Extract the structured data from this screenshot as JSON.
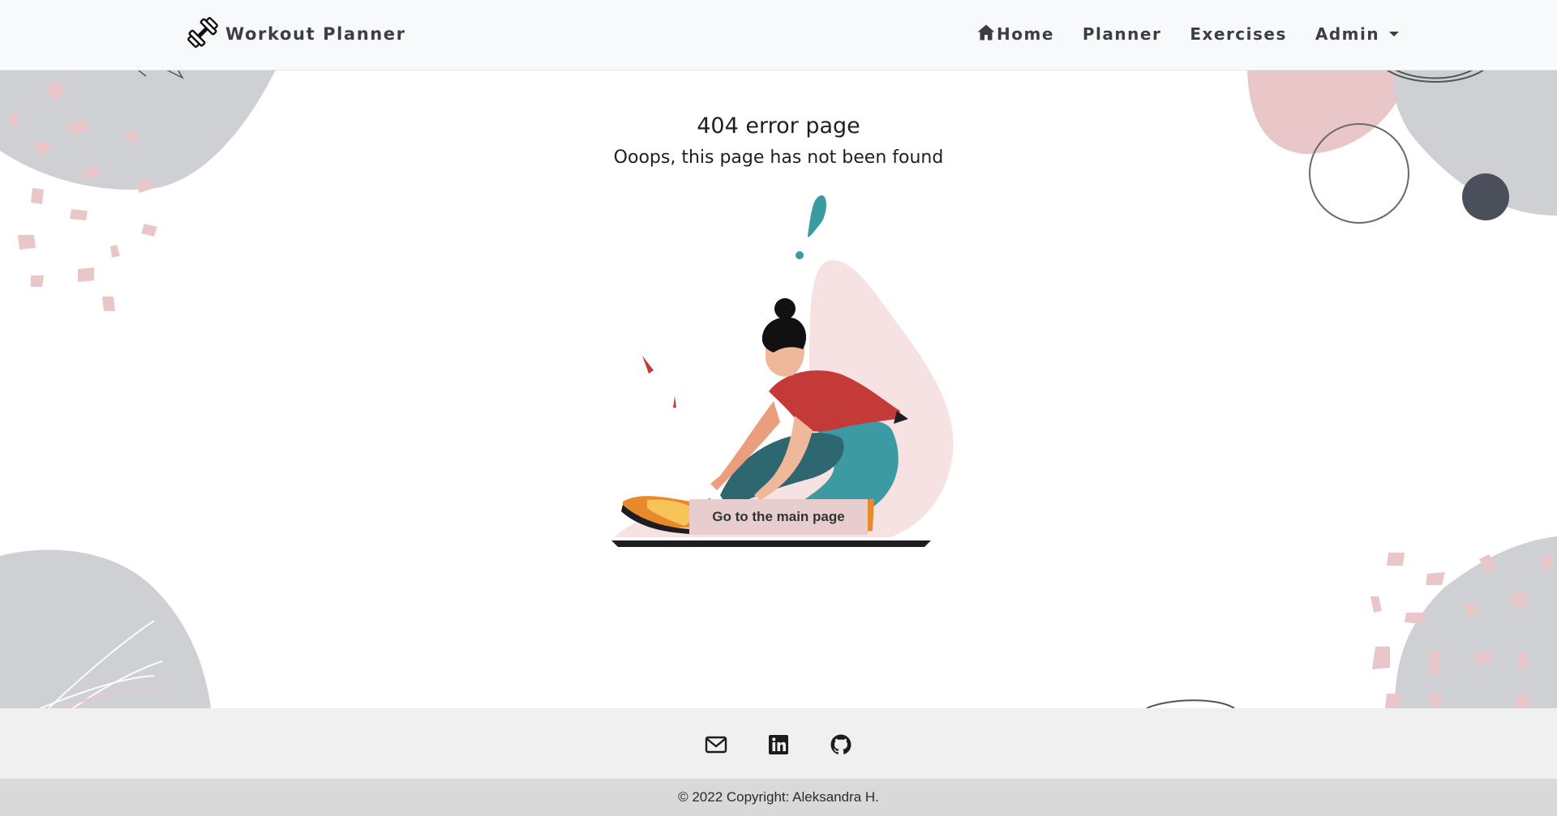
{
  "brand": {
    "name": "Workout Planner",
    "icon": "dumbbell-icon"
  },
  "nav": {
    "home": "Home",
    "planner": "Planner",
    "exercises": "Exercises",
    "admin": "Admin"
  },
  "main": {
    "title": "404 error page",
    "subtitle": "Ooops, this page has not been found",
    "button": "Go to the main page"
  },
  "footer": {
    "icons": [
      "envelope-icon",
      "linkedin-icon",
      "github-icon"
    ],
    "copyright": "© 2022 Copyright: Aleksandra H."
  },
  "colors": {
    "navbar_bg": "#f8f9fa",
    "button_bg": "#e8cdce",
    "footer_top": "#f0f0f0",
    "footer_bottom": "#d9d9d9",
    "blob_gray": "#cfd0d3",
    "blob_pink": "#e9c7c9",
    "accent_teal": "#3c9aa2"
  }
}
